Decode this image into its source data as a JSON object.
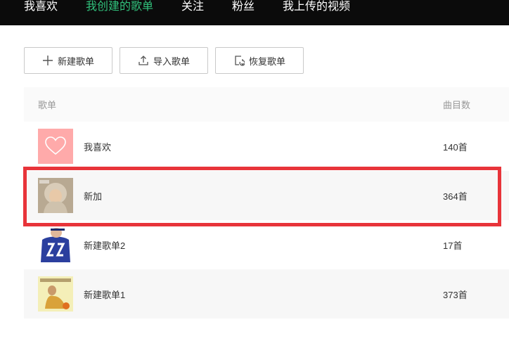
{
  "nav": {
    "tabs": [
      {
        "label": "我喜欢"
      },
      {
        "label": "我创建的歌单"
      },
      {
        "label": "关注"
      },
      {
        "label": "粉丝"
      },
      {
        "label": "我上传的视频"
      }
    ],
    "active_color": "#31c27c"
  },
  "toolbar": {
    "new_label": "新建歌单",
    "import_label": "导入歌单",
    "restore_label": "恢复歌单"
  },
  "table": {
    "col_name": "歌单",
    "col_count": "曲目数",
    "rows": [
      {
        "name": "我喜欢",
        "count": "140首",
        "cover_icon": "heart-icon"
      },
      {
        "name": "新加",
        "count": "364首"
      },
      {
        "name": "新建歌单2",
        "count": "17首"
      },
      {
        "name": "新建歌单1",
        "count": "373首"
      }
    ]
  },
  "highlight_color": "#e8343a"
}
